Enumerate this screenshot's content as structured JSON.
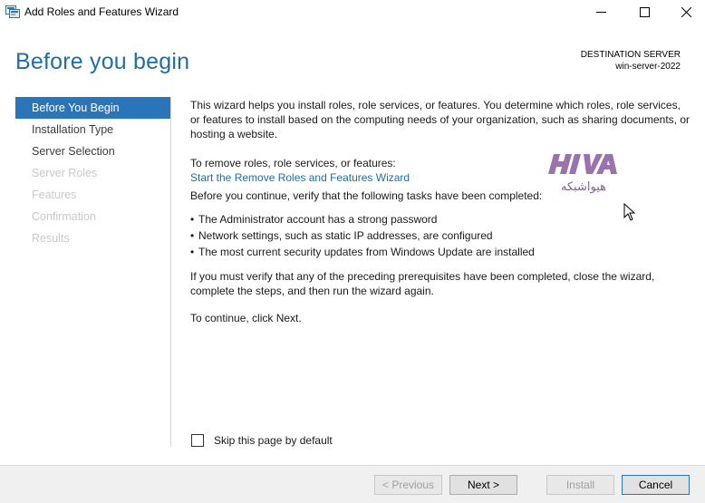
{
  "window": {
    "title": "Add Roles and Features Wizard",
    "controls": [
      "minimize-icon",
      "maximize-icon",
      "close-icon"
    ]
  },
  "header": {
    "title": "Before you begin",
    "destination_label": "DESTINATION SERVER",
    "destination_server": "win-server-2022"
  },
  "nav": {
    "items": [
      {
        "label": "Before You Begin",
        "state": "active"
      },
      {
        "label": "Installation Type",
        "state": "enabled"
      },
      {
        "label": "Server Selection",
        "state": "enabled"
      },
      {
        "label": "Server Roles",
        "state": "disabled"
      },
      {
        "label": "Features",
        "state": "disabled"
      },
      {
        "label": "Confirmation",
        "state": "disabled"
      },
      {
        "label": "Results",
        "state": "disabled"
      }
    ]
  },
  "content": {
    "intro": "This wizard helps you install roles, role services, or features. You determine which roles, role services, or features to install based on the computing needs of your organization, such as sharing documents, or hosting a website.",
    "remove_prompt": "To remove roles, role services, or features:",
    "remove_link": "Start the Remove Roles and Features Wizard",
    "verify_text": "Before you continue, verify that the following tasks have been completed:",
    "tasks": [
      "The Administrator account has a strong password",
      "Network settings, such as static IP addresses, are configured",
      "The most current security updates from Windows Update are installed"
    ],
    "prereq_text": "If you must verify that any of the preceding prerequisites have been completed, close the wizard, complete the steps, and then run the wizard again.",
    "continue_text": "To continue, click Next."
  },
  "watermark": {
    "latin": "HIVA",
    "persian": "هیواشبکه",
    "color": "#7a3f8e"
  },
  "skip_checkbox": {
    "label": "Skip this page by default",
    "checked": false
  },
  "footer": {
    "previous_label": "< Previous",
    "next_label": "Next >",
    "install_label": "Install",
    "cancel_label": "Cancel"
  },
  "colors": {
    "accent": "#1e6fa3",
    "nav_active_bg": "#2a74b9",
    "disabled_text": "#c9c9c9"
  }
}
